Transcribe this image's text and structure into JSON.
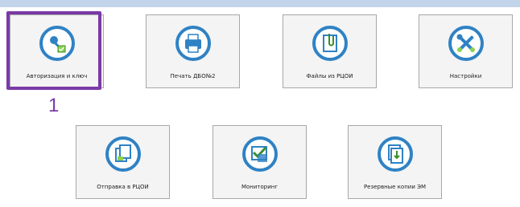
{
  "tiles": [
    {
      "label": "Авторизация и ключ",
      "icon": "key-check-icon"
    },
    {
      "label": "Печать ДБО№2",
      "icon": "printer-icon"
    },
    {
      "label": "Файлы из РЦОИ",
      "icon": "clip-document-icon"
    },
    {
      "label": "Настройки",
      "icon": "tools-icon"
    },
    {
      "label": "Отправка в РЦОИ",
      "icon": "send-documents-icon"
    },
    {
      "label": "Мониторинг",
      "icon": "monitoring-check-icon"
    },
    {
      "label": "Резервные копии ЭМ",
      "icon": "backup-copies-icon"
    }
  ],
  "annotation": {
    "number": "1"
  },
  "colors": {
    "icon_ring": "#2f82c4",
    "highlight": "#7a3aa6",
    "top_bar": "#c2d4ea"
  }
}
